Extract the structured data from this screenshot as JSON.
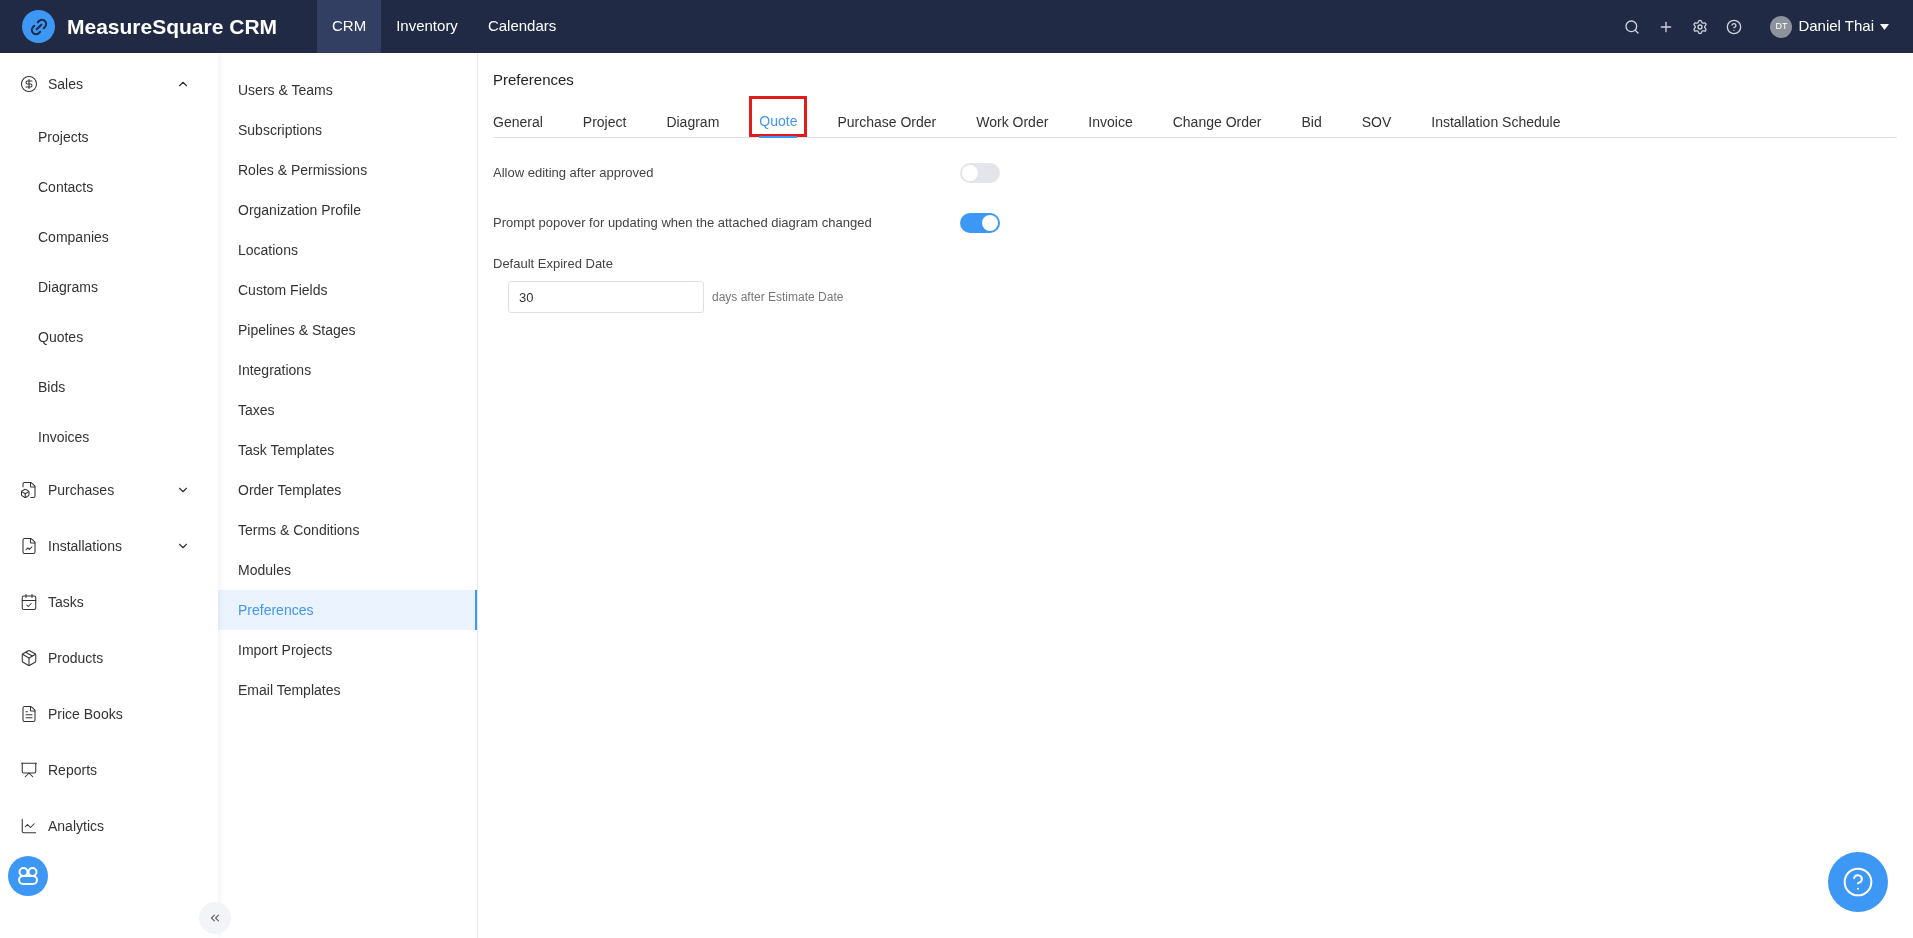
{
  "app": {
    "name": "MeasureSquare CRM"
  },
  "top_nav": [
    {
      "label": "CRM",
      "selected": true
    },
    {
      "label": "Inventory",
      "selected": false
    },
    {
      "label": "Calendars",
      "selected": false
    }
  ],
  "user": {
    "initials": "DT",
    "name": "Daniel Thai"
  },
  "sidebar": {
    "items": [
      {
        "label": "Sales",
        "kind": "group",
        "expanded": true,
        "children": [
          {
            "label": "Projects"
          },
          {
            "label": "Contacts"
          },
          {
            "label": "Companies"
          },
          {
            "label": "Diagrams"
          },
          {
            "label": "Quotes"
          },
          {
            "label": "Bids"
          },
          {
            "label": "Invoices"
          }
        ]
      },
      {
        "label": "Purchases",
        "kind": "group",
        "expanded": false
      },
      {
        "label": "Installations",
        "kind": "group",
        "expanded": false
      },
      {
        "label": "Tasks",
        "kind": "link"
      },
      {
        "label": "Products",
        "kind": "link"
      },
      {
        "label": "Price Books",
        "kind": "link"
      },
      {
        "label": "Reports",
        "kind": "link"
      },
      {
        "label": "Analytics",
        "kind": "link"
      }
    ]
  },
  "settings_nav": [
    {
      "label": "Users & Teams",
      "selected": false
    },
    {
      "label": "Subscriptions",
      "selected": false
    },
    {
      "label": "Roles & Permissions",
      "selected": false
    },
    {
      "label": "Organization Profile",
      "selected": false
    },
    {
      "label": "Locations",
      "selected": false
    },
    {
      "label": "Custom Fields",
      "selected": false
    },
    {
      "label": "Pipelines & Stages",
      "selected": false
    },
    {
      "label": "Integrations",
      "selected": false
    },
    {
      "label": "Taxes",
      "selected": false
    },
    {
      "label": "Task Templates",
      "selected": false
    },
    {
      "label": "Order Templates",
      "selected": false
    },
    {
      "label": "Terms & Conditions",
      "selected": false
    },
    {
      "label": "Modules",
      "selected": false
    },
    {
      "label": "Preferences",
      "selected": true
    },
    {
      "label": "Import Projects",
      "selected": false
    },
    {
      "label": "Email Templates",
      "selected": false
    }
  ],
  "page": {
    "title": "Preferences",
    "tabs": [
      {
        "label": "General",
        "selected": false,
        "highlighted": false
      },
      {
        "label": "Project",
        "selected": false,
        "highlighted": false
      },
      {
        "label": "Diagram",
        "selected": false,
        "highlighted": false
      },
      {
        "label": "Quote",
        "selected": true,
        "highlighted": true
      },
      {
        "label": "Purchase Order",
        "selected": false,
        "highlighted": false
      },
      {
        "label": "Work Order",
        "selected": false,
        "highlighted": false
      },
      {
        "label": "Invoice",
        "selected": false,
        "highlighted": false
      },
      {
        "label": "Change Order",
        "selected": false,
        "highlighted": false
      },
      {
        "label": "Bid",
        "selected": false,
        "highlighted": false
      },
      {
        "label": "SOV",
        "selected": false,
        "highlighted": false
      },
      {
        "label": "Installation Schedule",
        "selected": false,
        "highlighted": false
      }
    ],
    "settings": [
      {
        "label": "Allow editing after approved",
        "on": false
      },
      {
        "label": "Prompt popover for updating when the attached diagram changed",
        "on": true
      }
    ],
    "expired_date": {
      "label": "Default Expired Date",
      "value": "30",
      "suffix": "days after Estimate Date"
    }
  }
}
